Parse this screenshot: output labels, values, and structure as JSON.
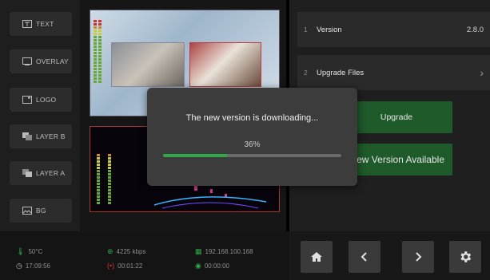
{
  "sidebar": {
    "items": [
      {
        "label": "TEXT",
        "icon": "text-icon"
      },
      {
        "label": "OVERLAY",
        "icon": "overlay-icon"
      },
      {
        "label": "LOGO",
        "icon": "logo-icon"
      },
      {
        "label": "LAYER B",
        "icon": "layer-b-icon"
      },
      {
        "label": "LAYER A",
        "icon": "layer-a-icon"
      },
      {
        "label": "BG",
        "icon": "background-image-icon"
      }
    ]
  },
  "upgrade_panel": {
    "version_row": {
      "num": "1",
      "label": "Version",
      "value": "2.8.0"
    },
    "files_row": {
      "num": "2",
      "label": "Upgrade Files"
    },
    "upgrade_button": "Upgrade",
    "new_version_button": "New Version Available"
  },
  "status": {
    "temperature": "50°C",
    "clock": "17:09:56",
    "bitrate": "4225 kbps",
    "record_time": "00:01:22",
    "ip": "192.168.100.168",
    "stream_time": "00:00:00"
  },
  "modal": {
    "title": "The new version is downloading...",
    "percent_label": "36%",
    "progress": 0.36
  },
  "colors": {
    "accent_green": "#2fa84a",
    "button_green": "#1f5a2a",
    "pvw_border": "#c03a3a"
  }
}
